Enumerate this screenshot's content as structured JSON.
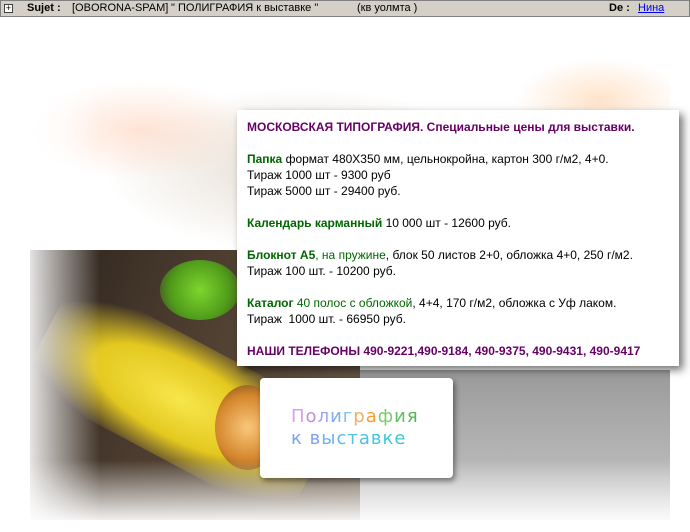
{
  "header": {
    "expander": "+",
    "sujet_label": "Sujet :",
    "tag": "[OBORONA-SPAM]",
    "subject": "\" ПОЛИГРАФИЯ к выставке \"",
    "sender_name": "(кв уолмта )",
    "de_label": "De :",
    "de_link": "Нина"
  },
  "info": {
    "heading": "МОСКОВСКАЯ ТИПОГРАФИЯ. Специальные цены для выставки.",
    "papka": {
      "name": "Папка",
      "desc": " формат 480Х350 мм, цельнокройна, картон 300 г/м2, 4+0.",
      "line2": "Тираж 1000 шт - 9300 руб",
      "line3": "Тираж 5000 шт - 29400 руб."
    },
    "calendar": {
      "name": "Календарь карманный",
      "desc": " 10 000 шт - 12600 руб."
    },
    "notepad": {
      "name": "Блокнот А5",
      "extra": ", на пружине",
      "desc": ", блок 50 листов 2+0, обложка 4+0, 250 г/м2.",
      "line2": "Тираж 100 шт. - 10200 руб."
    },
    "catalog": {
      "name": "Каталог",
      "extra": " 40 полос с обложкой",
      "desc": ", 4+4, 170 г/м2, обложка с Уф лаком.",
      "line2": "Тираж  1000 шт. - 66950 руб."
    },
    "phones": "НАШИ ТЕЛЕФОНЫ 490-9221,490-9184, 490-9375, 490-9431, 490-9417"
  },
  "logo": {
    "line1_letters": [
      {
        "ch": "П",
        "color": "#d9a0e8"
      },
      {
        "ch": "о",
        "color": "#c090e0"
      },
      {
        "ch": "л",
        "color": "#9aa6f0"
      },
      {
        "ch": "и",
        "color": "#7fb0f0"
      },
      {
        "ch": "г",
        "color": "#7fc0f0"
      },
      {
        "ch": "р",
        "color": "#f0b060"
      },
      {
        "ch": "а",
        "color": "#ff9a30"
      },
      {
        "ch": "ф",
        "color": "#7fc870"
      },
      {
        "ch": "и",
        "color": "#60c060"
      },
      {
        "ch": "я",
        "color": "#50b850"
      }
    ],
    "line2_letters": [
      {
        "ch": "к",
        "color": "#7fa0f0"
      },
      {
        "ch": " ",
        "color": "#000000"
      },
      {
        "ch": "в",
        "color": "#7fa0f0"
      },
      {
        "ch": "ы",
        "color": "#6fb0f0"
      },
      {
        "ch": "с",
        "color": "#5fb8f0"
      },
      {
        "ch": "т",
        "color": "#50c0e8"
      },
      {
        "ch": "а",
        "color": "#50c0e0"
      },
      {
        "ch": "в",
        "color": "#40c8e0"
      },
      {
        "ch": "к",
        "color": "#40c8d8"
      },
      {
        "ch": "е",
        "color": "#40c8d0"
      }
    ]
  }
}
